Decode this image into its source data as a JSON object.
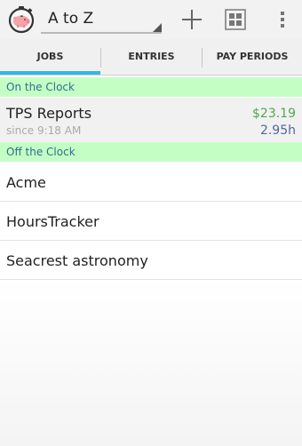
{
  "actionbar": {
    "app_icon": "stopwatch-piggy-bank-icon",
    "sort_value": "A to Z",
    "add_icon": "plus-icon",
    "grid_icon": "grid-view-icon",
    "menu_icon": "overflow-menu-icon"
  },
  "tabs": [
    {
      "label": "JOBS",
      "selected": true
    },
    {
      "label": "ENTRIES",
      "selected": false
    },
    {
      "label": "PAY PERIODS",
      "selected": false
    }
  ],
  "sections": {
    "on_clock": "On the Clock",
    "off_clock": "Off the Clock"
  },
  "active_job": {
    "name": "TPS Reports",
    "since": "since 9:18 AM",
    "amount": "$23.19",
    "hours": "2.95h"
  },
  "jobs": [
    {
      "name": "Acme"
    },
    {
      "name": "HoursTracker"
    },
    {
      "name": "Seacrest astronomy"
    }
  ],
  "colors": {
    "accent": "#33b5e5",
    "section_bg": "#c5fec5",
    "section_text": "#2c6f8f",
    "amount": "#4fa84f",
    "hours": "#5067a0"
  }
}
